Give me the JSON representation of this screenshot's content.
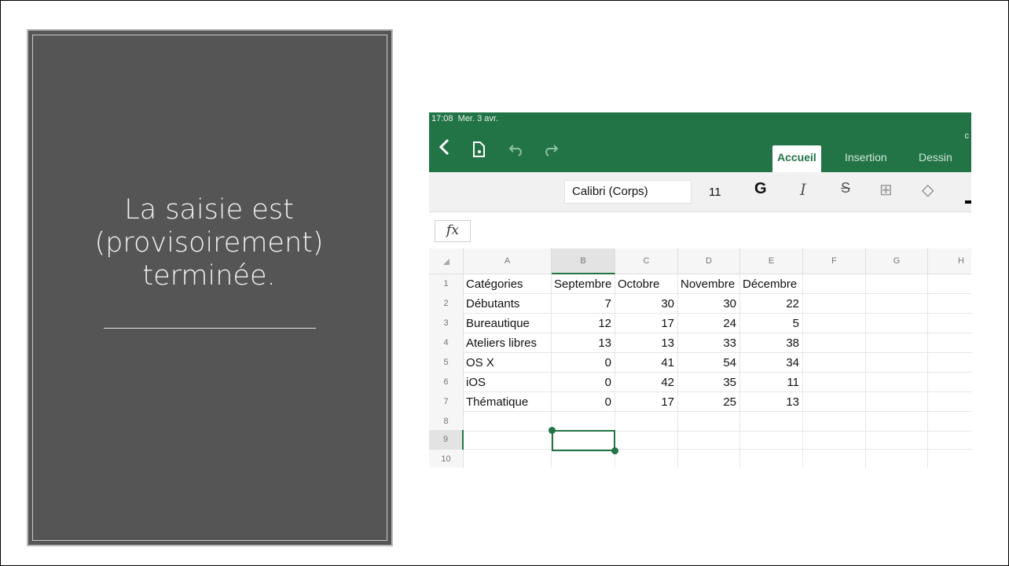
{
  "slide": {
    "title": "La saisie est (provisoirement) terminée."
  },
  "device": {
    "time": "17:08",
    "date": "Mer. 3 avr.",
    "corner_letter": "c"
  },
  "icons": {
    "back": "chevron-left-icon",
    "file": "file-icon",
    "undo": "undo-icon",
    "redo": "redo-icon",
    "bold": "bold-icon",
    "italic": "italic-icon",
    "strike": "strikethrough-icon",
    "borders": "borders-icon",
    "fill": "fill-color-icon"
  },
  "tabs": [
    {
      "label": "Accueil",
      "active": true
    },
    {
      "label": "Insertion",
      "active": false
    },
    {
      "label": "Dessin",
      "active": false
    }
  ],
  "ribbon": {
    "font_name": "Calibri (Corps)",
    "font_size": "11",
    "bold": "G",
    "italic": "I",
    "strike": "S",
    "borders": "⊞",
    "fill": "◇"
  },
  "formula_bar": {
    "fx": "fx",
    "content": ""
  },
  "sheet": {
    "columns": [
      "A",
      "B",
      "C",
      "D",
      "E",
      "F",
      "G",
      "H"
    ],
    "rows": [
      "1",
      "2",
      "3",
      "4",
      "5",
      "6",
      "7",
      "8",
      "9",
      "10"
    ],
    "cells": [
      [
        "Catégories",
        "Septembre",
        "Octobre",
        "Novembre",
        "Décembre",
        "",
        "",
        ""
      ],
      [
        "Débutants",
        "7",
        "30",
        "30",
        "22",
        "",
        "",
        ""
      ],
      [
        "Bureautique",
        "12",
        "17",
        "24",
        "5",
        "",
        "",
        ""
      ],
      [
        "Ateliers libres",
        "13",
        "13",
        "33",
        "38",
        "",
        "",
        ""
      ],
      [
        "OS X",
        "0",
        "41",
        "54",
        "34",
        "",
        "",
        ""
      ],
      [
        "iOS",
        "0",
        "42",
        "35",
        "11",
        "",
        "",
        ""
      ],
      [
        "Thématique",
        "0",
        "17",
        "25",
        "13",
        "",
        "",
        ""
      ],
      [
        "",
        "",
        "",
        "",
        "",
        "",
        "",
        ""
      ],
      [
        "",
        "",
        "",
        "",
        "",
        "",
        "",
        ""
      ],
      [
        "",
        "",
        "",
        "",
        "",
        "",
        "",
        ""
      ]
    ],
    "selected_cell": "B9",
    "accent": "#227447"
  }
}
